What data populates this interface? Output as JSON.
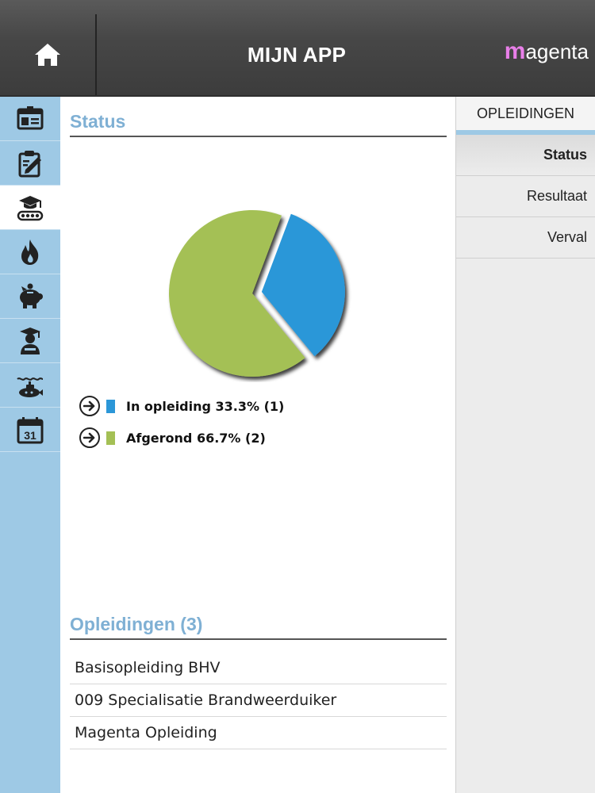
{
  "header": {
    "title": "MIJN APP",
    "brand_initial": "m",
    "brand_rest": "agenta",
    "home_icon": "home-icon"
  },
  "sidebar": {
    "items": [
      {
        "icon": "id-card-icon",
        "active": false
      },
      {
        "icon": "clipboard-edit-icon",
        "active": false
      },
      {
        "icon": "graduation-tank-icon",
        "active": true
      },
      {
        "icon": "fire-icon",
        "active": false
      },
      {
        "icon": "piggy-bank-icon",
        "active": false
      },
      {
        "icon": "graduate-person-icon",
        "active": false
      },
      {
        "icon": "submarine-icon",
        "active": false
      },
      {
        "icon": "calendar-icon",
        "active": false,
        "text": "31"
      }
    ]
  },
  "status": {
    "title": "Status",
    "legend": [
      {
        "label": "In opleiding 33.3% (1)",
        "color": "#2b97d8"
      },
      {
        "label": "Afgerond 66.7% (2)",
        "color": "#a4c055"
      }
    ]
  },
  "chart_data": {
    "type": "pie",
    "categories": [
      "In opleiding",
      "Afgerond"
    ],
    "values": [
      1,
      2
    ],
    "percentages": [
      33.3,
      66.7
    ],
    "colors": [
      "#2b97d8",
      "#a4c055"
    ]
  },
  "opleidingen": {
    "title": "Opleidingen (3)",
    "items": [
      "Basisopleiding BHV",
      "009 Specialisatie Brandweerduiker",
      "Magenta Opleiding"
    ]
  },
  "right_panel": {
    "header": "OPLEIDINGEN",
    "items": [
      {
        "label": "Status",
        "active": true
      },
      {
        "label": "Resultaat",
        "active": false
      },
      {
        "label": "Verval",
        "active": false
      }
    ]
  },
  "colors": {
    "accent": "#9ec9e5",
    "title_blue": "#7fb0d4",
    "brand_pink": "#e87fe8"
  }
}
